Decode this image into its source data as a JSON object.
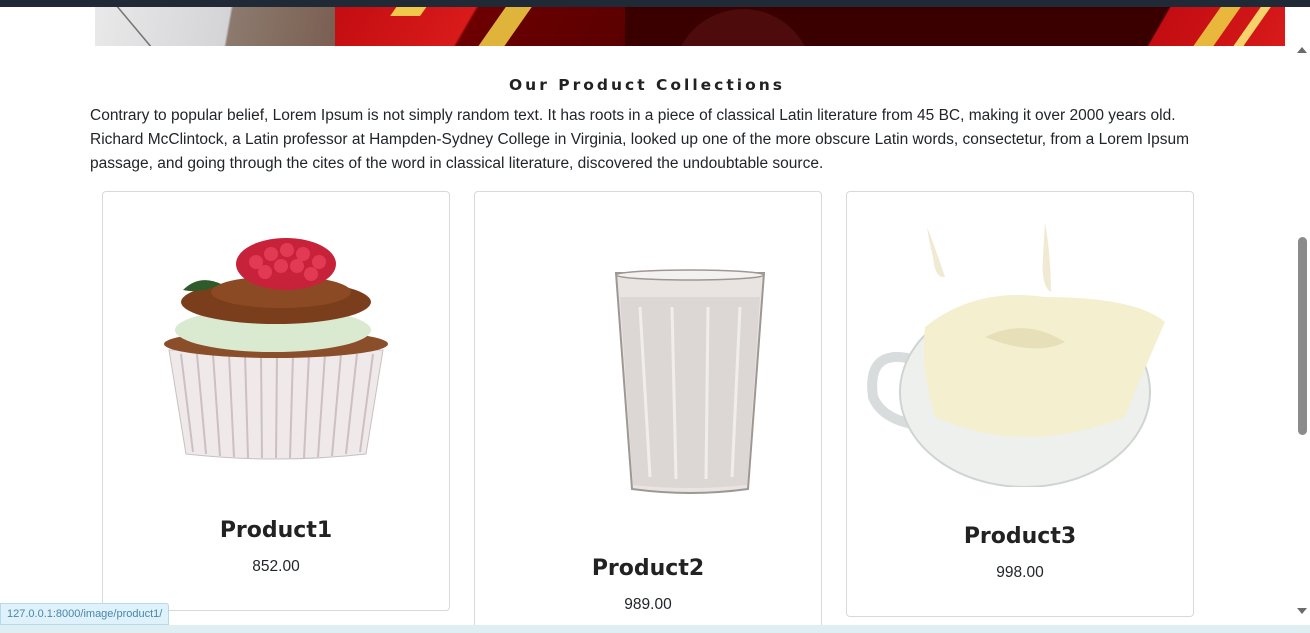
{
  "section": {
    "title": "Our Product Collections",
    "intro": "Contrary to popular belief, Lorem Ipsum is not simply random text. It has roots in a piece of classical Latin literature from 45 BC, making it over 2000 years old. Richard McClintock, a Latin professor at Hampden-Sydney College in Virginia, looked up one of the more obscure Latin words, consectetur, from a Lorem Ipsum passage, and going through the cites of the word in classical literature, discovered the undoubtable source."
  },
  "products": [
    {
      "name": "Product1",
      "price": "852.00",
      "image": "cupcake-with-raspberry"
    },
    {
      "name": "Product2",
      "price": "989.00",
      "image": "glass-of-milk"
    },
    {
      "name": "Product3",
      "price": "998.00",
      "image": "milk-splash-cup"
    }
  ],
  "status_bar": {
    "url": "127.0.0.1:8000/image/product1/"
  },
  "colors": {
    "accent_red": "#c30d12",
    "gold": "#e0b43a",
    "text": "#212529"
  }
}
